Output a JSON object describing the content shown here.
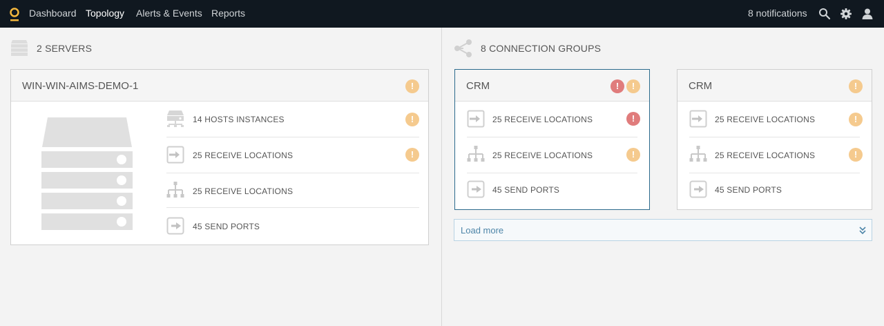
{
  "nav": {
    "items": [
      {
        "label": "Dashboard",
        "active": false
      },
      {
        "label": "Topology",
        "active": true
      },
      {
        "label": "Alerts & Events",
        "active": false
      },
      {
        "label": "Reports",
        "active": false
      }
    ],
    "notifications": "8 notifications"
  },
  "servers": {
    "title": "2 SERVERS",
    "card": {
      "title": "WIN-WIN-AIMS-DEMO-1",
      "status": "warning",
      "rows": [
        {
          "label": "14 HOSTS INSTANCES",
          "icon": "host-instances-icon",
          "status": "warning"
        },
        {
          "label": "25 RECEIVE LOCATIONS",
          "icon": "receive-location-icon",
          "status": "warning"
        },
        {
          "label": "25 RECEIVE LOCATIONS",
          "icon": "network-hierarchy-icon",
          "status": "none"
        },
        {
          "label": "45 SEND PORTS",
          "icon": "send-port-icon",
          "status": "none"
        }
      ]
    }
  },
  "connection_groups": {
    "title": "8 CONNECTION GROUPS",
    "cards": [
      {
        "title": "CRM",
        "selected": true,
        "status": [
          "error",
          "warning"
        ],
        "rows": [
          {
            "label": "25 RECEIVE LOCATIONS",
            "icon": "receive-location-icon",
            "status": "error"
          },
          {
            "label": "25 RECEIVE LOCATIONS",
            "icon": "network-hierarchy-icon",
            "status": "warning"
          },
          {
            "label": "45 SEND PORTS",
            "icon": "send-port-icon",
            "status": "none"
          }
        ]
      },
      {
        "title": "CRM",
        "selected": false,
        "status": [
          "warning"
        ],
        "rows": [
          {
            "label": "25 RECEIVE LOCATIONS",
            "icon": "receive-location-icon",
            "status": "warning"
          },
          {
            "label": "25 RECEIVE LOCATIONS",
            "icon": "network-hierarchy-icon",
            "status": "warning"
          },
          {
            "label": "45 SEND PORTS",
            "icon": "send-port-icon",
            "status": "none"
          }
        ]
      }
    ],
    "load_more": "Load more"
  },
  "badge_glyph": "!",
  "colors": {
    "nav_bg": "#101820",
    "brand": "#f5b83d",
    "warning": "#f5ca8e",
    "error": "#e07c7c",
    "selected_border": "#2b6a8c",
    "link": "#4d85a8"
  }
}
